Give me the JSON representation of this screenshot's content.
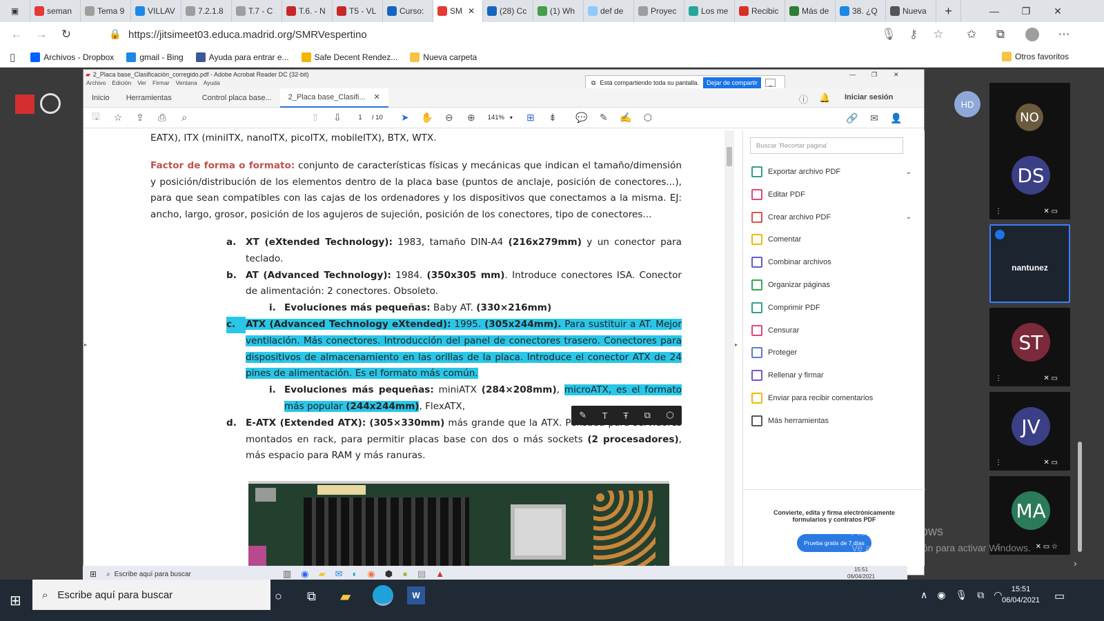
{
  "browser": {
    "tabs": [
      {
        "label": "seman",
        "color": "#e53935"
      },
      {
        "label": "Tema 9",
        "color": "#9e9e9e"
      },
      {
        "label": "VILLAV",
        "color": "#1e88e5"
      },
      {
        "label": "7.2.1.8",
        "color": "#9e9e9e"
      },
      {
        "label": "T.7 - C",
        "color": "#9e9e9e"
      },
      {
        "label": "T.6. - N",
        "color": "#c62828"
      },
      {
        "label": "T5 - VL",
        "color": "#c62828"
      },
      {
        "label": "Curso:",
        "color": "#1565c0"
      },
      {
        "label": "SM",
        "color": "#e53935",
        "active": true
      },
      {
        "label": "(28) Cc",
        "color": "#1565c0"
      },
      {
        "label": "(1) Wh",
        "color": "#43a047"
      },
      {
        "label": "def de",
        "color": "#90caf9"
      },
      {
        "label": "Proyec",
        "color": "#9e9e9e"
      },
      {
        "label": "Los me",
        "color": "#26a69a"
      },
      {
        "label": "Recibic",
        "color": "#d93025"
      },
      {
        "label": "Más de",
        "color": "#2e7d32"
      },
      {
        "label": "38. ¿Q",
        "color": "#1e88e5"
      },
      {
        "label": "Nueva",
        "color": "#555555"
      }
    ],
    "url": "https://jitsimeet03.educa.madrid.org/SMRVespertino",
    "favorites": [
      {
        "label": "Archivos - Dropbox",
        "color": "#0061ff"
      },
      {
        "label": "gmail - Bing",
        "color": "#1e88e5"
      },
      {
        "label": "Ayuda para entrar e...",
        "color": "#3b5998"
      },
      {
        "label": "Safe Decent Rendez...",
        "color": "#f4b400"
      },
      {
        "label": "Nueva carpeta",
        "color": "#f6c343"
      }
    ],
    "other_favorites": "Otros favoritos"
  },
  "acrobat": {
    "title": "2_Placa base_Clasificación_corregido.pdf - Adobe Acrobat Reader DC (32-bit)",
    "menu": [
      "Archivo",
      "Edición",
      "Ver",
      "Firmar",
      "Ventana",
      "Ayuda"
    ],
    "tabs": [
      "Inicio",
      "Herramientas",
      "Control placa base...",
      "2_Placa base_Clasifi..."
    ],
    "signin": "Iniciar sesión",
    "page_current": "1",
    "page_total": "/ 10",
    "zoom": "141%",
    "share_banner": "Está compartiendo toda su pantalla.",
    "share_stop": "Dejar de compartir",
    "search_placeholder": "Buscar 'Recortar página'",
    "tools": [
      {
        "label": "Exportar archivo PDF",
        "color": "#2e9e8e",
        "expand": true
      },
      {
        "label": "Editar PDF",
        "color": "#e0457b"
      },
      {
        "label": "Crear archivo PDF",
        "color": "#d9534f",
        "expand": true
      },
      {
        "label": "Comentar",
        "color": "#f2b705"
      },
      {
        "label": "Combinar archivos",
        "color": "#5b5bd6"
      },
      {
        "label": "Organizar páginas",
        "color": "#3aa64a"
      },
      {
        "label": "Comprimir PDF",
        "color": "#2e9e8e"
      },
      {
        "label": "Censurar",
        "color": "#e0457b"
      },
      {
        "label": "Proteger",
        "color": "#5b7bd6"
      },
      {
        "label": "Rellenar y firmar",
        "color": "#7b52c6"
      },
      {
        "label": "Enviar para recibir comentarios",
        "color": "#f2b705"
      },
      {
        "label": "Más herramientas",
        "color": "#555555"
      }
    ],
    "promo_text": "Convierte, edita y firma electrónicamente formularios y contratos PDF",
    "promo_button": "Prueba gratis de 7 días"
  },
  "pdf": {
    "line0": "EATX), ITX (miniITX, nanoITX, picoITX, mobileITX), BTX, WTX.",
    "ff_label": "Factor de forma o formato:",
    "ff_text": " conjunto de características físicas y mecánicas que indican el tamaño/dimensión y posición/distribución de los elementos dentro de la placa base (puntos de anclaje, posición de conectores...), para que sean compatibles con las cajas de los ordenadores y los dispositivos que conectamos a la misma. EJ: ancho, largo, grosor, posición de los agujeros de sujeción, posición de los conectores, tipo de conectores...",
    "a_mark": "a.",
    "a_bold": "XT (eXtended Technology):",
    "a_text1": " 1983, tamaño DIN-A4 ",
    "a_bold2": "(216x279mm)",
    "a_text2": " y un conector para teclado.",
    "b_mark": "b.",
    "b_bold": "AT (Advanced Technology):",
    "b_text1": " 1984. ",
    "b_bold2": "(350x305 mm)",
    "b_text2": ". Introduce conectores ISA. Conector de alimentación: 2 conectores. Obsoleto.",
    "bi_mark": "i.",
    "bi_bold": "Evoluciones más pequeñas:",
    "bi_text": " Baby AT. ",
    "bi_bold2": "(330×216mm)",
    "c_mark": "c.",
    "c_bold": "ATX (Advanced Technology eXtended):",
    "c_text1": " 1995. ",
    "c_bold2": "(305x244mm).",
    "c_text2": " Para sustituir a AT. Mejor ventilación. Más conectores.  Introducción del panel de conectores trasero. Conectores para dispositivos de almacenamiento en las orillas de la placa. Introduce el conector ATX de 24 pines de alimentación. Es el formato más común.",
    "ci_mark": "i.",
    "ci_bold": "Evoluciones más pequeñas:",
    "ci_text1": " miniATX ",
    "ci_bold2": "(284×208mm)",
    "ci_text2": ", ",
    "ci_hl": "microATX, es el formato más popular ",
    "ci_hl_bold": "(244x244mm)",
    "ci_text3": ", FlexATX,",
    "d_mark": "d.",
    "d_bold": "E-ATX (Extended ATX):",
    "d_text1": " ",
    "d_bold2": "(305×330mm)",
    "d_text2": " más grande que la ATX. Pensada para servidores montados en rack, para permitir placas base con dos o más sockets ",
    "d_bold3": "(2 procesadores)",
    "d_text3": ", más espacio para RAM y más ranuras."
  },
  "meeting": {
    "logo": "EducaMadrid",
    "self_initials": "HD",
    "participants": [
      {
        "initials": "NO",
        "color": "#6b5a3e"
      },
      {
        "initials": "DS",
        "color": "#3b3f86"
      },
      {
        "initials": "ST",
        "color": "#7a2a3a"
      },
      {
        "initials": "JV",
        "color": "#3b3f86"
      },
      {
        "initials": "MA",
        "color": "#2b7a5a"
      }
    ],
    "sharer": "nantunez",
    "watermark1": "Activar Windows",
    "watermark2": "Ve a Configuración para activar Windows."
  },
  "inner_taskbar": {
    "search": "Escribe aquí para buscar",
    "time": "15:51",
    "date": "06/04/2021"
  },
  "taskbar": {
    "search": "Escribe aquí para buscar",
    "time": "15:51",
    "date": "06/04/2021"
  }
}
